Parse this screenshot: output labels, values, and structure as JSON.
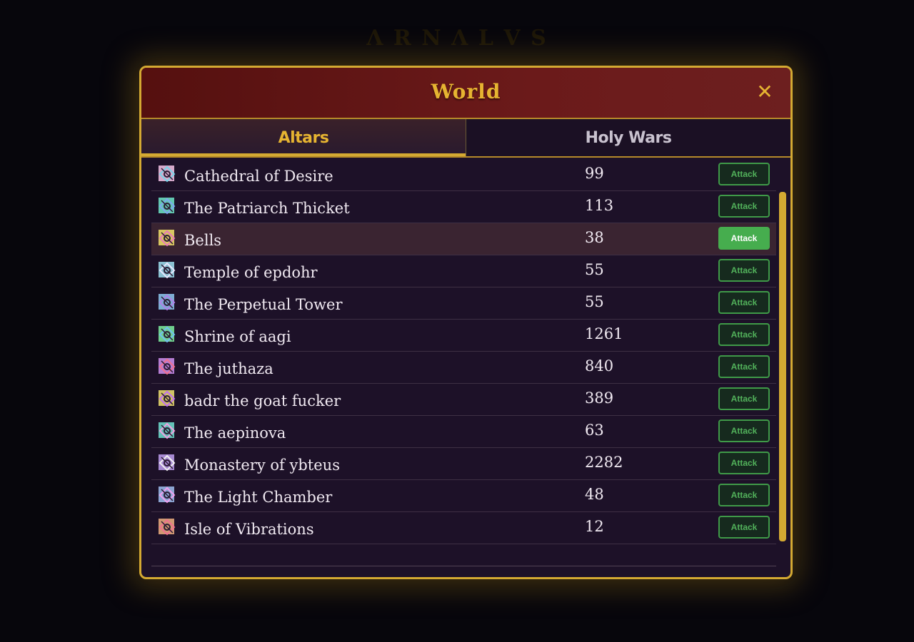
{
  "background_title": "Λ R N Λ L V S",
  "dialog": {
    "title": "World",
    "close_label": "✕"
  },
  "tabs": [
    {
      "label": "Altars",
      "active": true
    },
    {
      "label": "Holy Wars",
      "active": false
    }
  ],
  "altars": [
    {
      "name": "Cathedral of Desire",
      "score": "99",
      "action": "Attack",
      "icon": "altar-sigil-icon"
    },
    {
      "name": "The Patriarch Thicket",
      "score": "113",
      "action": "Attack",
      "icon": "altar-sigil-icon"
    },
    {
      "name": "Bells",
      "score": "38",
      "action": "Attack",
      "icon": "altar-sigil-icon",
      "highlighted": true
    },
    {
      "name": "Temple of epdohr",
      "score": "55",
      "action": "Attack",
      "icon": "altar-sigil-icon"
    },
    {
      "name": "The Perpetual Tower",
      "score": "55",
      "action": "Attack",
      "icon": "altar-sigil-icon"
    },
    {
      "name": "Shrine of aagi",
      "score": "1261",
      "action": "Attack",
      "icon": "altar-sigil-icon"
    },
    {
      "name": "The juthaza",
      "score": "840",
      "action": "Attack",
      "icon": "altar-sigil-icon"
    },
    {
      "name": "badr the goat fucker",
      "score": "389",
      "action": "Attack",
      "icon": "altar-sigil-icon"
    },
    {
      "name": "The aepinova",
      "score": "63",
      "action": "Attack",
      "icon": "altar-sigil-icon"
    },
    {
      "name": "Monastery of ybteus",
      "score": "2282",
      "action": "Attack",
      "icon": "altar-sigil-icon"
    },
    {
      "name": "The Light Chamber",
      "score": "48",
      "action": "Attack",
      "icon": "altar-sigil-icon"
    },
    {
      "name": "Isle of Vibrations",
      "score": "12",
      "action": "Attack",
      "icon": "altar-sigil-icon"
    }
  ],
  "colors": {
    "accent_gold": "#d4a932",
    "header_red": "#6b1a1a",
    "attack_green": "#46ad4e",
    "panel_bg": "#1d1128"
  }
}
